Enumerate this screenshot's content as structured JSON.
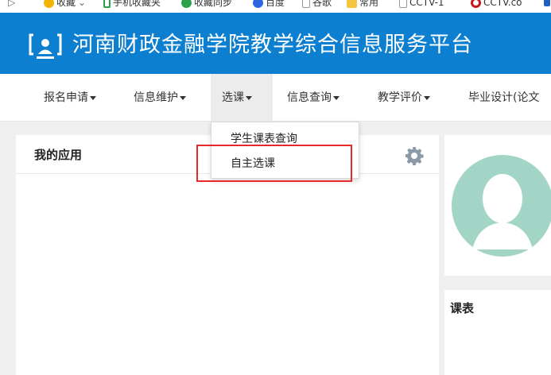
{
  "bookmarks": [
    {
      "label": "收藏",
      "icon": "star-folder-icon",
      "color": "#f2b400"
    },
    {
      "label": "手机收藏夹",
      "icon": "phone-icon",
      "color": "#2aa14a"
    },
    {
      "label": "收藏同步",
      "icon": "sync-icon",
      "color": "#2aa14a"
    },
    {
      "label": "百度",
      "icon": "paw-icon",
      "color": "#2d66e0"
    },
    {
      "label": "谷歌",
      "icon": "page-icon",
      "color": "#999999"
    },
    {
      "label": "常用",
      "icon": "folder-icon",
      "color": "#f5c542"
    },
    {
      "label": "CCTV-1",
      "icon": "page-icon",
      "color": "#999999"
    },
    {
      "label": "CCTV.co",
      "icon": "cctv-icon",
      "color": "#c8161d"
    }
  ],
  "header": {
    "title": "河南财政金融学院教学综合信息服务平台",
    "color": "#0c7fd1"
  },
  "nav": {
    "items": [
      {
        "label": "报名申请"
      },
      {
        "label": "信息维护"
      },
      {
        "label": "选课"
      },
      {
        "label": "信息查询"
      },
      {
        "label": "教学评价"
      },
      {
        "label": "毕业设计(论文"
      }
    ]
  },
  "dropdown": {
    "items": [
      {
        "label": "学生课表查询"
      },
      {
        "label": "自主选课"
      }
    ]
  },
  "panels": {
    "apps_title": "我的应用",
    "schedule_title": "课表"
  }
}
